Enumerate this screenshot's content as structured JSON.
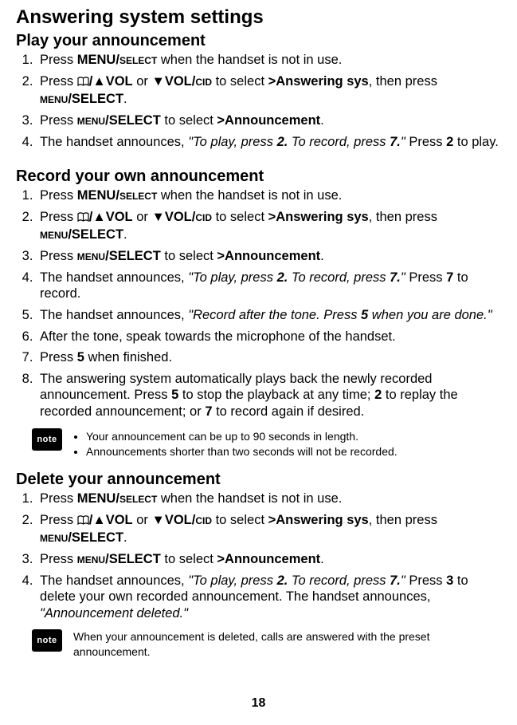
{
  "title": "Answering system settings",
  "pageNumber": "18",
  "noteLabel": "note",
  "glyphs": {
    "triUp": "▲",
    "triDown": "▼"
  },
  "sec1": {
    "heading": "Play your announcement",
    "s1a": "Press ",
    "s1b": "MENU/",
    "s1c": "SELECT",
    "s1d": " when the handset is not in use.",
    "s2a": "Press ",
    "s2b": "/",
    "s2c": "VOL",
    "s2d": " or ",
    "s2e": "VOL/",
    "s2f": "CID",
    "s2g": " to select ",
    "s2h": ">Answering sys",
    "s2i": ", then press ",
    "s2j": "MENU",
    "s2k": "/SELECT",
    "s2l": ".",
    "s3a": "Press ",
    "s3b": "MENU",
    "s3c": "/SELECT",
    "s3d": " to select ",
    "s3e": ">Announcement",
    "s3f": ".",
    "s4a": "The handset announces, ",
    "s4b": "\"To play, press ",
    "s4c": "2.",
    "s4d": " To record, press ",
    "s4e": "7.",
    "s4f": "\"",
    "s4g": "  Press ",
    "s4h": "2",
    "s4i": " to play."
  },
  "sec2": {
    "heading": "Record your own announcement",
    "s1a": "Press ",
    "s1b": "MENU/",
    "s1c": "SELECT",
    "s1d": " when the handset is not in use.",
    "s2a": "Press ",
    "s2b": "/",
    "s2c": "VOL",
    "s2d": " or ",
    "s2e": "VOL/",
    "s2f": "CID",
    "s2g": " to select ",
    "s2h": ">Answering sys",
    "s2i": ", then press ",
    "s2j": "MENU",
    "s2k": "/SELECT",
    "s2l": ".",
    "s3a": "Press ",
    "s3b": "MENU",
    "s3c": "/SELECT",
    "s3d": " to select ",
    "s3e": ">Announcement",
    "s3f": ".",
    "s4a": "The handset announces, ",
    "s4b": "\"To play, press ",
    "s4c": "2.",
    "s4d": " To record, press ",
    "s4e": "7.",
    "s4f": "\"",
    "s4g": "  Press ",
    "s4h": "7",
    "s4i": " to record.",
    "s5a": "The handset announces, ",
    "s5b": "\"Record after the tone. Press ",
    "s5c": "5",
    "s5d": " when you are done.\"",
    "s6": "After the tone, speak towards the microphone of the handset.",
    "s7a": "Press ",
    "s7b": "5",
    "s7c": " when finished.",
    "s8a": "The answering system automatically plays back the newly recorded announcement. Press ",
    "s8b": "5",
    "s8c": " to stop the playback at any time; ",
    "s8d": "2",
    "s8e": " to replay the recorded announcement; or ",
    "s8f": "7",
    "s8g": " to record again if desired.",
    "note1": "Your announcement can be up to 90 seconds in length.",
    "note2": "Announcements shorter than two seconds will not be recorded."
  },
  "sec3": {
    "heading": "Delete your announcement",
    "s1a": "Press ",
    "s1b": "MENU/",
    "s1c": "SELECT",
    "s1d": " when the handset is not in use.",
    "s2a": "Press ",
    "s2b": "/",
    "s2c": "VOL",
    "s2d": " or ",
    "s2e": "VOL/",
    "s2f": "CID",
    "s2g": " to select ",
    "s2h": ">Answering sys",
    "s2i": ", then press ",
    "s2j": "MENU",
    "s2k": "/SELECT",
    "s2l": ".",
    "s3a": "Press ",
    "s3b": "MENU",
    "s3c": "/SELECT",
    "s3d": " to select ",
    "s3e": ">Announcement",
    "s3f": ".",
    "s4a": "The handset announces, ",
    "s4b": "\"To play, press ",
    "s4c": "2.",
    "s4d": " To record, press ",
    "s4e": "7.",
    "s4f": "\"",
    "s4g": "  Press ",
    "s4h": "3",
    "s4i": " to delete your own recorded announcement. The handset announces, ",
    "s4j": "\"Announcement deleted.\"",
    "note": "When your announcement is deleted, calls are answered with the preset announcement."
  }
}
